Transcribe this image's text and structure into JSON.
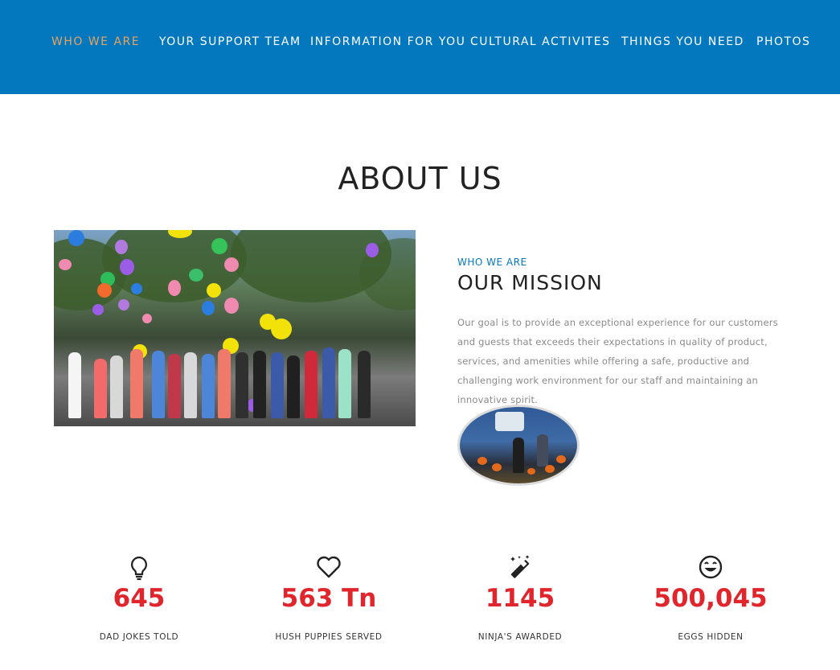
{
  "nav": {
    "items": [
      {
        "label": "WHO WE ARE",
        "active": true
      },
      {
        "label": "YOUR SUPPORT TEAM",
        "active": false
      },
      {
        "label": "INFORMATION FOR YOU",
        "active": false
      },
      {
        "label": "CULTURAL ACTIVITES",
        "active": false
      },
      {
        "label": "THINGS YOU NEED",
        "active": false
      },
      {
        "label": "PHOTOS",
        "active": false
      }
    ],
    "background": "#0378be",
    "active_color": "#e8a35f"
  },
  "about": {
    "title": "ABOUT US"
  },
  "mission": {
    "kicker": "WHO WE ARE",
    "title": "OUR MISSION",
    "text": "Our goal is to provide an exceptional experience for our customers and guests that exceeds their expectations in quality of product, services, and amenities while offering a safe, productive and challenging work environment for our staff and maintaining an innovative spirit."
  },
  "stats": [
    {
      "icon": "lightbulb-icon",
      "value": "645",
      "label": "DAD JOKES TOLD"
    },
    {
      "icon": "heart-icon",
      "value": "563 Tn",
      "label": "HUSH PUPPIES SERVED"
    },
    {
      "icon": "magic-wand-icon",
      "value": "1145",
      "label": "NINJA'S AWARDED"
    },
    {
      "icon": "smiley-icon",
      "value": "500,045",
      "label": "EGGS HIDDEN"
    }
  ],
  "colors": {
    "accent_red": "#e0262c",
    "accent_blue": "#0378be"
  }
}
